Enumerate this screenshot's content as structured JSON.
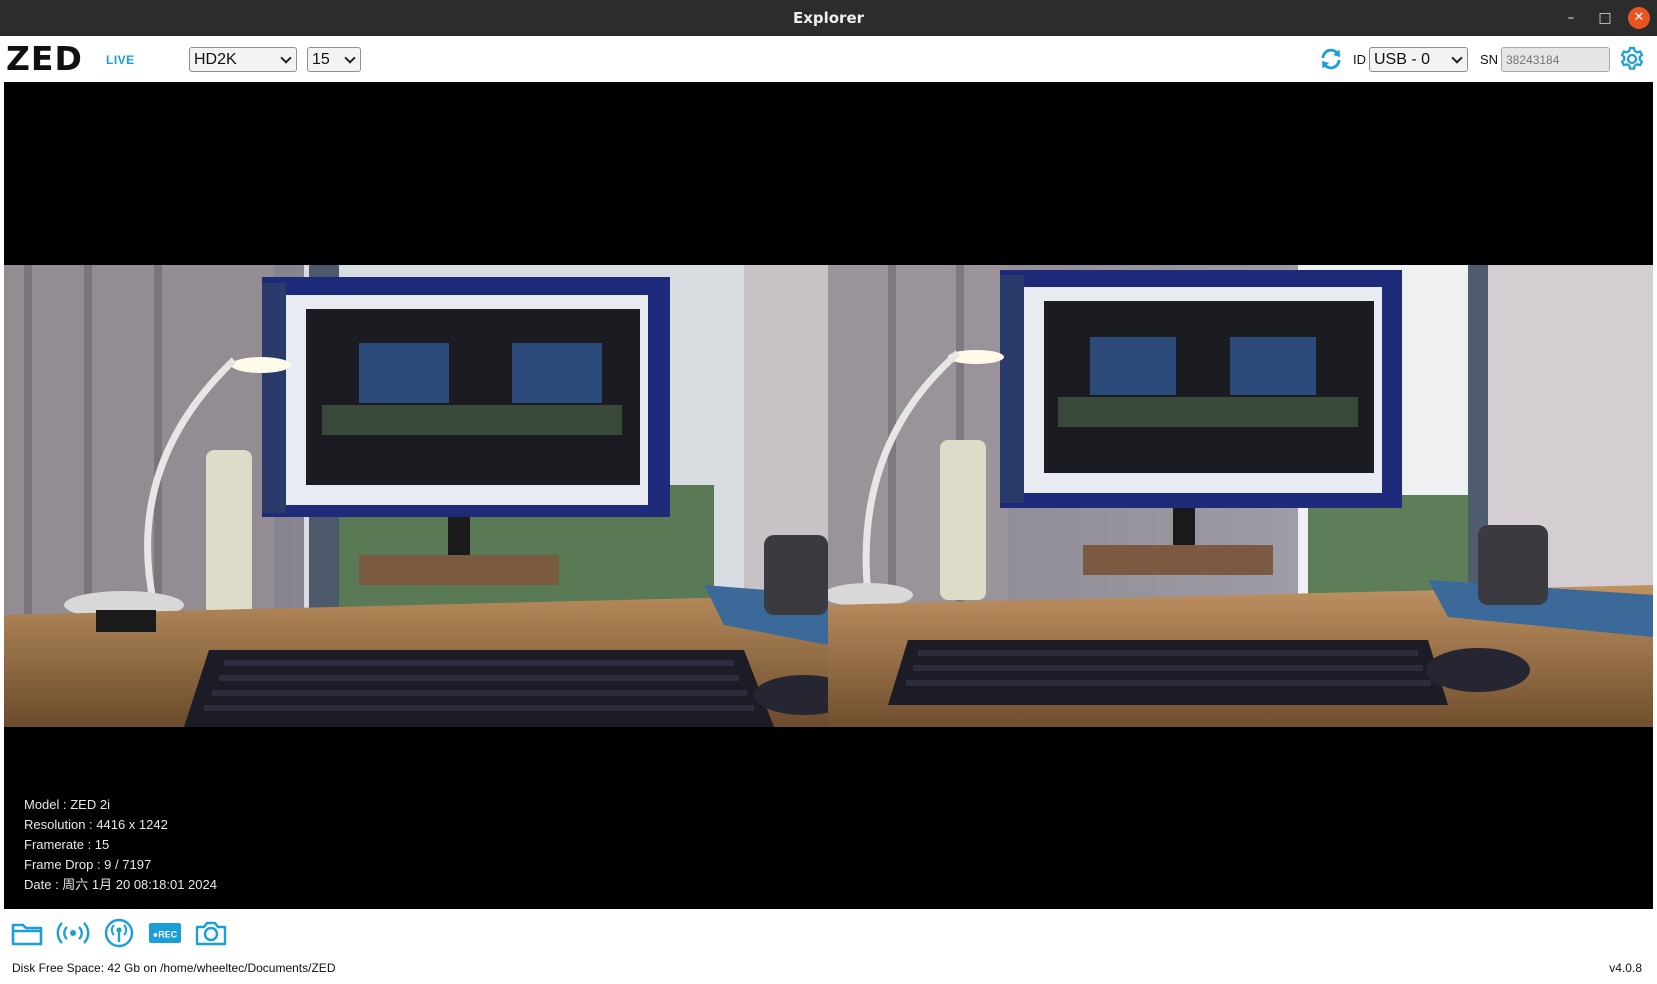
{
  "window": {
    "title": "Explorer",
    "minimize": "–",
    "maximize": "□",
    "close": "✕"
  },
  "toolbar": {
    "logo": "ZED",
    "live_label": "LIVE",
    "resolution": "HD2K",
    "framerate": "15",
    "id_label": "ID",
    "camera_id": "USB - 0",
    "sn_label": "SN",
    "sn_placeholder": "38243184",
    "accent_color": "#1a9fd9"
  },
  "info": {
    "model": "Model : ZED 2i",
    "resolution": "Resolution : 4416 x 1242",
    "framerate": "Framerate : 15",
    "frame_drop": "Frame Drop : 9 / 7197",
    "date": "Date : 周六 1月 20 08:18:01 2024"
  },
  "bottom": {
    "icons": [
      "folder-icon",
      "stream-icon",
      "broadcast-icon",
      "record-icon",
      "camera-icon"
    ],
    "rec_text": "●REC",
    "disk_free": "Disk Free Space: 42 Gb  on /home/wheeltec/Documents/ZED",
    "version": "v4.0.8"
  }
}
